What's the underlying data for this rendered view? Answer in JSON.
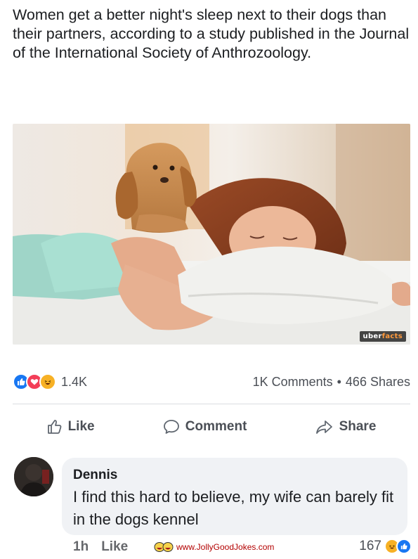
{
  "post": {
    "text": "Women get a better night's sleep next to their dogs than their partners, according to a study published in the Journal of the International Society of Anthrozoology.",
    "image_watermark_prefix": "uber",
    "image_watermark_suffix": "facts"
  },
  "stats": {
    "reaction_count": "1.4K",
    "comments": "1K Comments",
    "separator": "•",
    "shares": "466 Shares",
    "reactions": [
      "like-icon",
      "love-icon",
      "haha-icon"
    ]
  },
  "actions": {
    "like_label": "Like",
    "comment_label": "Comment",
    "share_label": "Share"
  },
  "comment": {
    "author": "Dennis",
    "text": "I find this hard to believe, my wife can barely fit in the dogs kennel",
    "time": "1h",
    "like_label": "Like",
    "reaction_count": "167"
  },
  "watermark_site": "www.JollyGoodJokes.com",
  "colors": {
    "facebook_blue": "#1877f2",
    "love_red": "#f33e58",
    "haha_yellow": "#f7b125",
    "text_secondary": "#65676b",
    "comment_bg": "#f0f2f5"
  }
}
